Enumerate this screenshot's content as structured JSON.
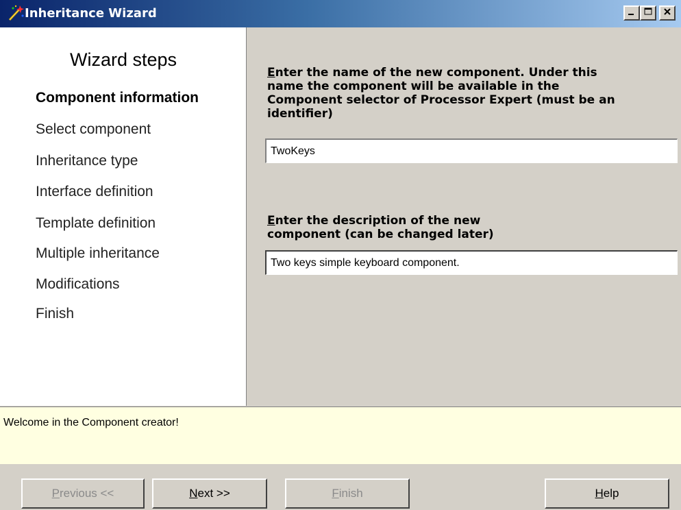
{
  "window": {
    "title": "Inheritance Wizard"
  },
  "steps": {
    "heading": "Wizard steps",
    "items": [
      {
        "label": "Component information",
        "active": true
      },
      {
        "label": "Select component",
        "active": false
      },
      {
        "label": "Inheritance type",
        "active": false
      },
      {
        "label": "Interface definition",
        "active": false
      },
      {
        "label": "Template definition",
        "active": false
      },
      {
        "label": "Multiple inheritance",
        "active": false
      },
      {
        "label": "Modifications",
        "active": false
      },
      {
        "label": "Finish",
        "active": false
      }
    ]
  },
  "form": {
    "name_prompt_first": "E",
    "name_prompt_rest_line1": "nter the name of the new component. Under this",
    "name_prompt_line2": "name the component will be available in the",
    "name_prompt_line3": "Component selector of Processor Expert (must be an",
    "name_prompt_line4": "identifier)",
    "name_value": "TwoKeys",
    "desc_prompt_first": "E",
    "desc_prompt_rest_line1": "nter the description of the new",
    "desc_prompt_line2": "component (can be changed later)",
    "desc_value": "Two keys simple keyboard component."
  },
  "status": {
    "message": "Welcome in the Component creator!"
  },
  "buttons": {
    "previous": {
      "mnemonic": "P",
      "rest": "revious <<",
      "enabled": false
    },
    "next": {
      "mnemonic": "N",
      "rest": "ext >>",
      "enabled": true
    },
    "finish": {
      "mnemonic": "F",
      "rest": "inish",
      "enabled": false
    },
    "help": {
      "mnemonic": "H",
      "rest": "elp",
      "enabled": true
    }
  },
  "icons": {
    "app": "wizard-wand-icon",
    "minimize": "minimize-icon",
    "maximize": "maximize-icon",
    "close": "close-icon"
  },
  "colors": {
    "titlebar_start": "#0a246a",
    "titlebar_end": "#a6caf0",
    "face": "#d4d0c8",
    "status_bg": "#ffffe1"
  }
}
